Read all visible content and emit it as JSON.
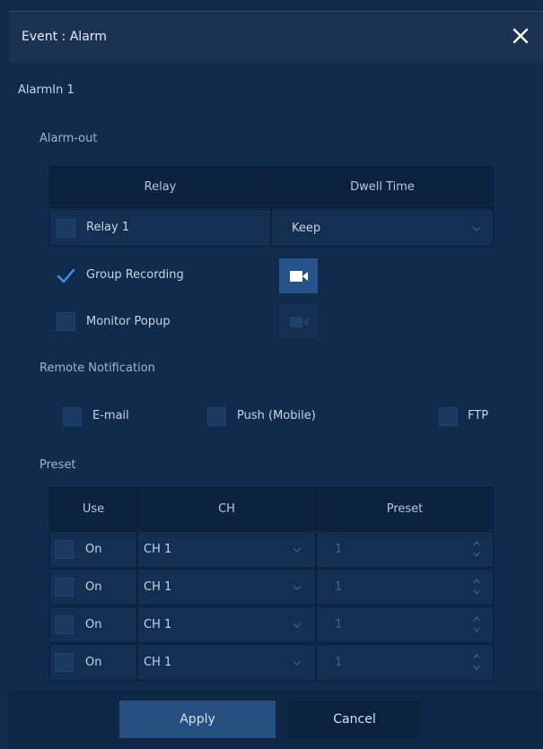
{
  "dialog": {
    "title": "Event : Alarm",
    "close_icon": "close-icon"
  },
  "alarm_in": {
    "label": "AlarmIn 1"
  },
  "alarm_out": {
    "section_label": "Alarm-out",
    "columns": [
      "Relay",
      "Dwell Time"
    ],
    "relay": {
      "label": "Relay 1",
      "checked": false,
      "dwell_value": "Keep"
    },
    "group_recording": {
      "label": "Group Recording",
      "checked": true
    },
    "monitor_popup": {
      "label": "Monitor Popup",
      "checked": false
    }
  },
  "remote_notification": {
    "section_label": "Remote Notification",
    "email": "E-mail",
    "push": "Push (Mobile)",
    "ftp": "FTP"
  },
  "preset": {
    "section_label": "Preset",
    "columns": [
      "Use",
      "CH",
      "Preset"
    ],
    "rows": [
      {
        "use": "On",
        "ch": "CH 1",
        "preset": "1"
      },
      {
        "use": "On",
        "ch": "CH 1",
        "preset": "1"
      },
      {
        "use": "On",
        "ch": "CH 1",
        "preset": "1"
      },
      {
        "use": "On",
        "ch": "CH 1",
        "preset": "1"
      }
    ]
  },
  "buttons": {
    "apply": "Apply",
    "cancel": "Cancel"
  },
  "colors": {
    "accent": "#25538a",
    "check": "#4a8ee8",
    "bg": "#102b4b"
  }
}
